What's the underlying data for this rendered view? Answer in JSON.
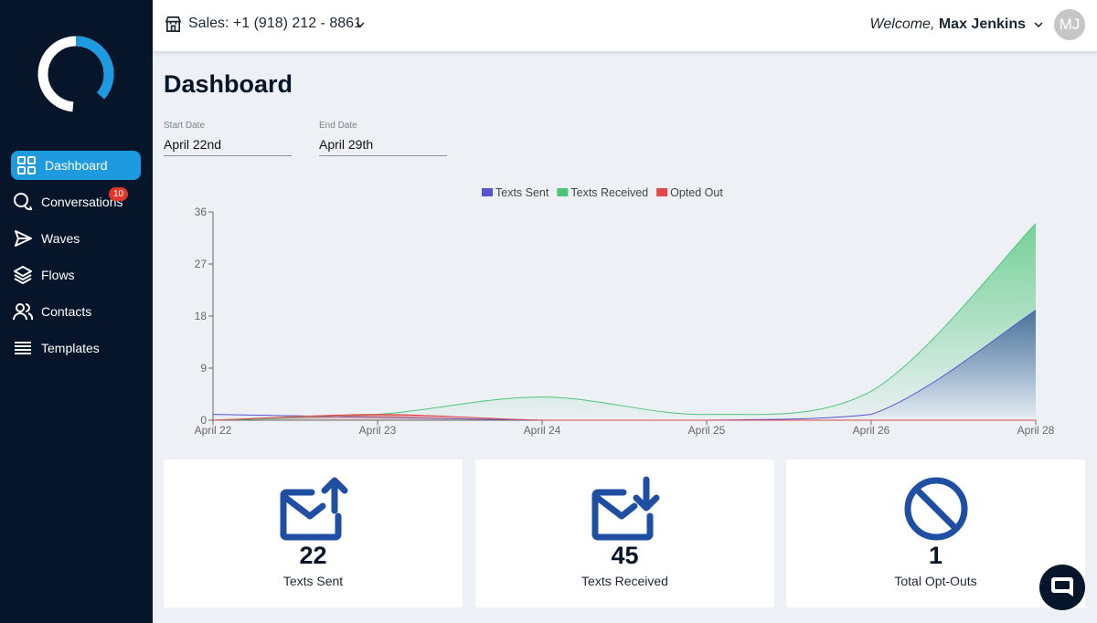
{
  "header": {
    "sales_label": "Sales: +1 (918) 212 - 8861",
    "welcome_prefix": "Welcome,",
    "user_name": "Max Jenkins",
    "avatar_initials": "MJ"
  },
  "sidebar": {
    "items": [
      {
        "label": "Dashboard",
        "icon": "grid-icon",
        "active": true
      },
      {
        "label": "Conversations",
        "icon": "chat-bubbles-icon",
        "badge": "10"
      },
      {
        "label": "Waves",
        "icon": "send-icon"
      },
      {
        "label": "Flows",
        "icon": "layers-icon"
      },
      {
        "label": "Contacts",
        "icon": "users-icon"
      },
      {
        "label": "Templates",
        "icon": "list-icon"
      }
    ]
  },
  "main": {
    "title": "Dashboard",
    "start_date_label": "Start Date",
    "start_date": "April 22nd",
    "end_date_label": "End Date",
    "end_date": "April 29th"
  },
  "chart_data": {
    "type": "area",
    "categories": [
      "April 22",
      "April 23",
      "April 24",
      "April 25",
      "April 26",
      "April 28"
    ],
    "y_ticks": [
      0,
      9,
      18,
      27,
      36
    ],
    "ylim": [
      0,
      36
    ],
    "legend_position": "top-center",
    "series": [
      {
        "name": "Texts Sent",
        "color": "#5555d4",
        "values": [
          1,
          0.5,
          0,
          0,
          1,
          19
        ]
      },
      {
        "name": "Texts Received",
        "color": "#4ec67a",
        "values": [
          0,
          1,
          4,
          1,
          5,
          34
        ]
      },
      {
        "name": "Opted Out",
        "color": "#e04848",
        "values": [
          0,
          1,
          0,
          0,
          0,
          0
        ]
      }
    ]
  },
  "cards": [
    {
      "value": "22",
      "label": "Texts Sent",
      "icon": "mail-send-icon"
    },
    {
      "value": "45",
      "label": "Texts Received",
      "icon": "mail-receive-icon"
    },
    {
      "value": "1",
      "label": "Total Opt-Outs",
      "icon": "block-icon"
    }
  ],
  "colors": {
    "sidebar_bg": "#061529",
    "accent": "#1e9be0",
    "icon_blue": "#1f4fa3"
  }
}
